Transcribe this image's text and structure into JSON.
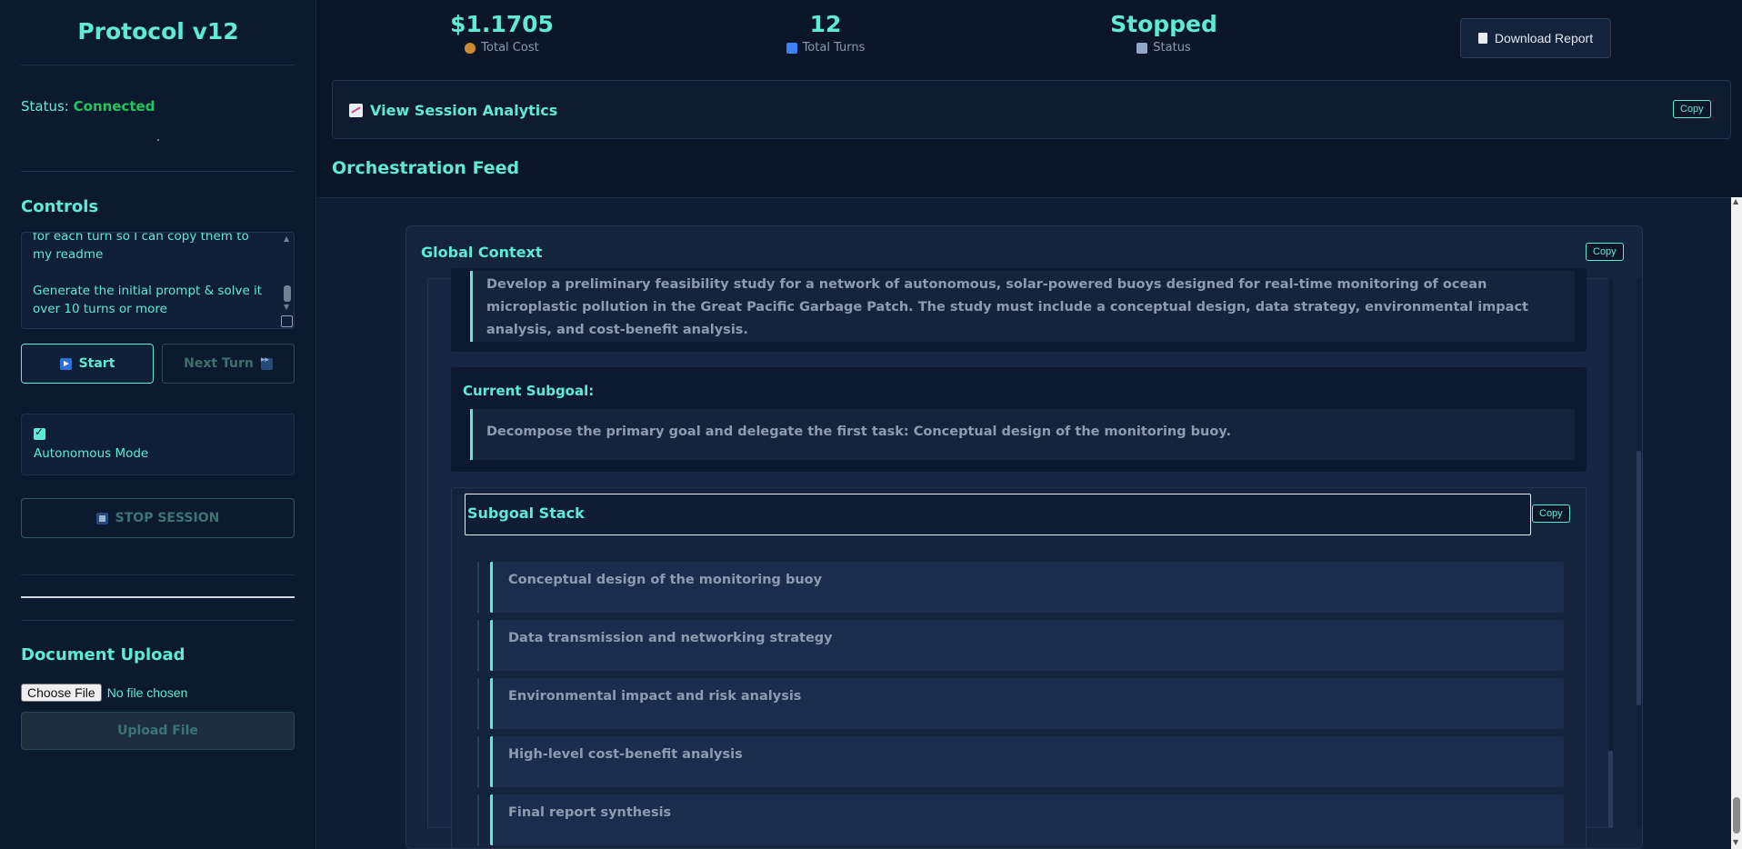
{
  "sidebar": {
    "title": "Protocol v12",
    "status_label": "Status:",
    "status_value": "Connected",
    "controls_title": "Controls",
    "prompt_text": "for each turn so I can copy them to my readme\n\nGenerate the initial prompt & solve it over 10 turns or more",
    "start_label": "Start",
    "next_turn_label": "Next Turn",
    "autonomous_label": "Autonomous Mode",
    "autonomous_checked": true,
    "stop_label": "STOP SESSION",
    "upload_title": "Document Upload",
    "choose_file_label": "Choose File",
    "no_file_label": "No file chosen",
    "upload_button_label": "Upload File"
  },
  "stats": {
    "cost_value": "$1.1705",
    "cost_label": "Total Cost",
    "turns_value": "12",
    "turns_label": "Total Turns",
    "status_value": "Stopped",
    "status_label": "Status",
    "download_label": "Download Report"
  },
  "analytics": {
    "title": "View Session Analytics",
    "copy_label": "Copy"
  },
  "feed": {
    "title": "Orchestration Feed",
    "global_context_title": "Global Context",
    "global_copy_label": "Copy",
    "primary_goal_text": "Develop a preliminary feasibility study for a network of autonomous, solar-powered buoys designed for real-time monitoring of ocean microplastic pollution in the Great Pacific Garbage Patch. The study must include a conceptual design, data strategy, environmental impact analysis, and cost-benefit analysis.",
    "current_subgoal_label": "Current Subgoal:",
    "current_subgoal_text": "Decompose the primary goal and delegate the first task: Conceptual design of the monitoring buoy.",
    "subgoal_stack_title": "Subgoal Stack",
    "stack_copy_label": "Copy",
    "subgoal_stack": [
      "Conceptual design of the monitoring buoy",
      "Data transmission and networking strategy",
      "Environmental impact and risk analysis",
      "High-level cost-benefit analysis",
      "Final report synthesis"
    ]
  },
  "colors": {
    "accent": "#5eead4",
    "connected": "#22c55e",
    "background": "#0b1629"
  }
}
